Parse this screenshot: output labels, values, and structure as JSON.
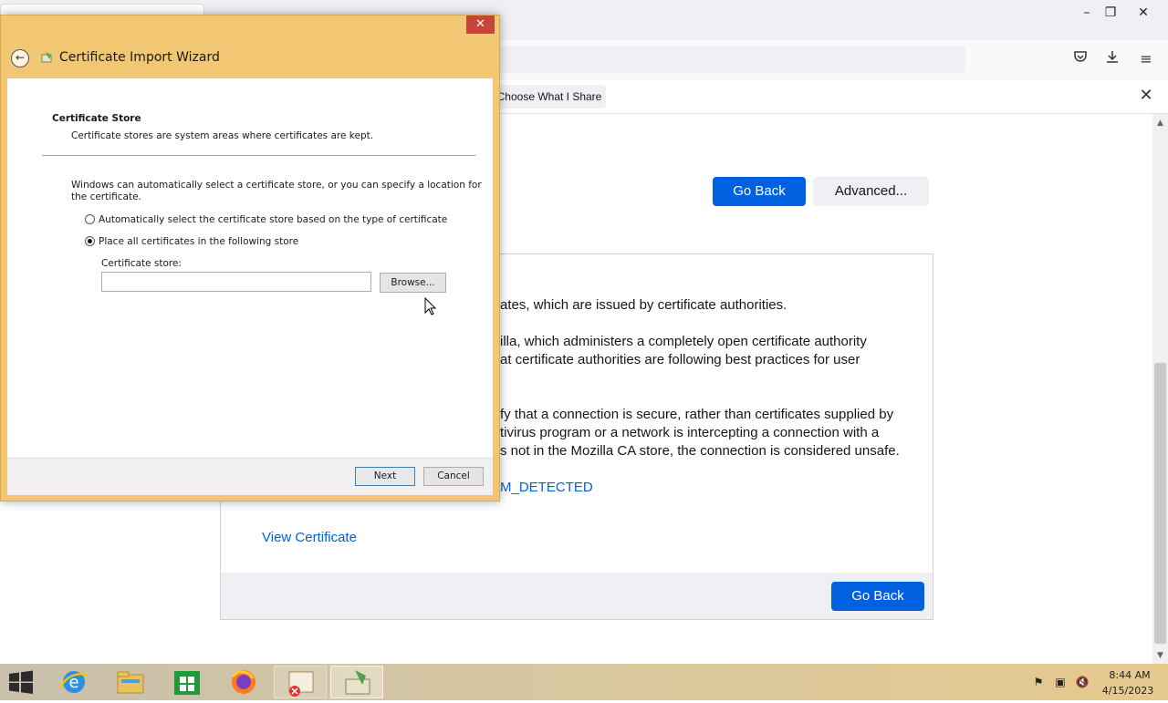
{
  "browser": {
    "notification": {
      "choose_share_label": "Choose What I Share"
    },
    "error_page": {
      "go_back_label": "Go Back",
      "advanced_label": "Advanced...",
      "paragraph1_line1": "ates, which are issued by certificate authorities.",
      "paragraph2_line1": "illa, which administers a completely open certificate authority",
      "paragraph2_line2": "at certificate authorities are following best practices for user",
      "paragraph3_line1": "fy that a connection is secure, rather than certificates supplied by",
      "paragraph3_line2": "tivirus program or a network is intercepting a connection with a",
      "paragraph3_line3": "s not in the Mozilla CA store, the connection is considered unsafe.",
      "error_code_link": "M_DETECTED",
      "view_certificate_link": "View Certificate",
      "go_back_bottom_label": "Go Back"
    }
  },
  "dialog": {
    "title": "Certificate Import Wizard",
    "close_glyph": "✕",
    "section_heading": "Certificate Store",
    "section_description": "Certificate stores are system areas where certificates are kept.",
    "intro_line1": "Windows can automatically select a certificate store, or you can specify a location for",
    "intro_line2": "the certificate.",
    "option_auto_label": "Automatically select the certificate store based on the type of certificate",
    "option_place_label": "Place all certificates in the following store",
    "option_selected": "place",
    "store_label": "Certificate store:",
    "store_value": "",
    "browse_label": "Browse...",
    "next_label": "Next",
    "cancel_label": "Cancel"
  },
  "taskbar": {
    "apps": [
      "start",
      "internet-explorer",
      "file-explorer",
      "store",
      "firefox",
      "certificate-manager",
      "certificate-import-wizard"
    ],
    "clock_time": "8:44 AM",
    "clock_date": "4/15/2023"
  },
  "colors": {
    "dialog_frame": "#f2c774",
    "primary_button": "#0061e0",
    "close_button": "#c7443a"
  }
}
